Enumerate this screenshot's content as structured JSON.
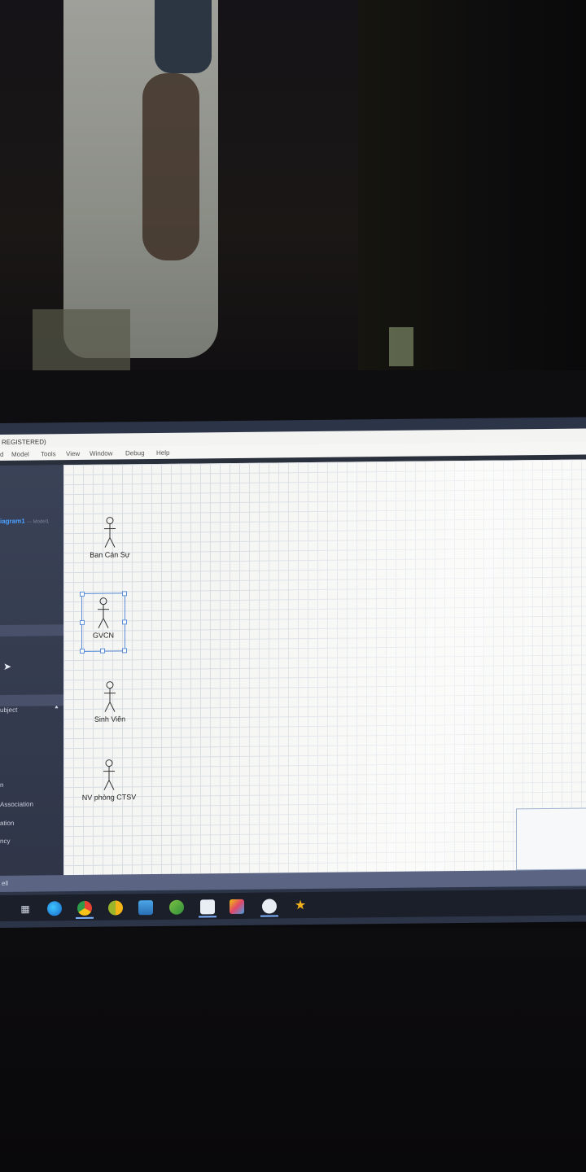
{
  "window": {
    "title": "REGISTERED)"
  },
  "menu": [
    "d",
    "Model",
    "Tools",
    "View",
    "Window",
    "Debug",
    "Help"
  ],
  "sidebar": {
    "diagram_tab": "iagram1",
    "diagram_sub": "— Model1",
    "items": [
      "ubject",
      "n",
      "Association",
      "ation",
      "ncy"
    ]
  },
  "canvas": {
    "actors": [
      {
        "name": "Ban Cán Sự",
        "selected": false
      },
      {
        "name": "GVCN",
        "selected": true
      },
      {
        "name": "Sinh Viên",
        "selected": false
      },
      {
        "name": "NV phòng CTSV",
        "selected": false
      }
    ]
  },
  "statusbar": {
    "text": "ell"
  },
  "taskbar": {
    "icons": [
      "task-view-icon",
      "edge-icon",
      "chrome-icon",
      "chrome-canary-icon",
      "photos-icon",
      "xbox-icon",
      "cube-app-icon",
      "paint-icon",
      "chat-icon",
      "star-app-icon"
    ]
  },
  "colors": {
    "canvas": "#f5f6f3",
    "grid": "#d8dde4",
    "sidebar": "#3a4257",
    "accent": "#4ba0ff",
    "selection": "#5a8ed8"
  }
}
